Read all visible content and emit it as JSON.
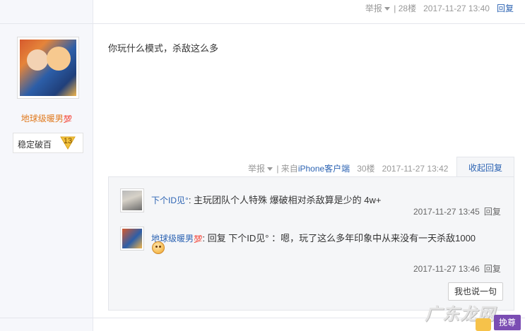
{
  "top_meta": {
    "report": "举报",
    "sep": "|",
    "floor": "28楼",
    "time": "2017-11-27 13:40",
    "reply": "回复"
  },
  "user": {
    "name": "地球级暖男",
    "name_badge": "💯",
    "rank_label": "稳定破百",
    "level": "13"
  },
  "post": {
    "text": "你玩什么模式，杀敌这么多",
    "report": "举报",
    "from_prefix": "| 来自",
    "client": "iPhone客户端",
    "floor": "30楼",
    "time": "2017-11-27 13:42",
    "collapse": "收起回复"
  },
  "replies": [
    {
      "nick": "下个ID见°",
      "text": ": 主玩团队个人特殊 爆破相对杀敌算是少的 4w+",
      "time": "2017-11-27 13:45",
      "reply": "回复"
    },
    {
      "nick": "地球级暖男",
      "nick_badge": "💯",
      "text": ": 回复 下个ID见° ：嗯，玩了这么多年印象中从来没有一天杀敌1000",
      "time": "2017-11-27 13:46",
      "reply": "回复"
    }
  ],
  "say_button": "我也说一句",
  "watermark": {
    "text": "广东龙网",
    "badge": "挽尊"
  },
  "colors": {
    "link": "#2d64b3",
    "username": "#e07a1f",
    "level_badge": "#f2c23c"
  }
}
